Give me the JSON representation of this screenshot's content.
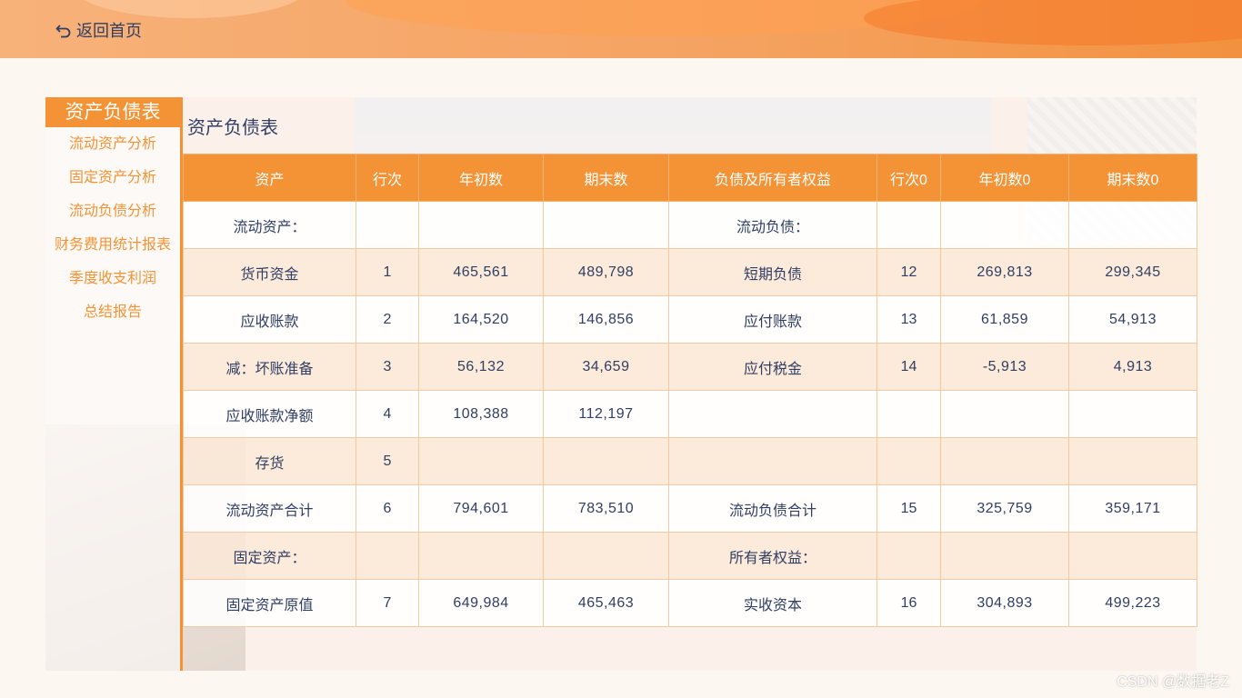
{
  "header": {
    "back_label": "返回首页"
  },
  "sidebar": {
    "title": "资产负债表",
    "items": [
      "流动资产分析",
      "固定资产分析",
      "流动负债分析",
      "财务费用统计报表",
      "季度收支利润",
      "总结报告"
    ]
  },
  "main": {
    "title": "资产负债表",
    "columns": [
      "资产",
      "行次",
      "年初数",
      "期末数",
      "负债及所有者权益",
      "行次0",
      "年初数0",
      "期末数0"
    ],
    "rows": [
      [
        "流动资产：",
        "",
        "",
        "",
        "流动负债：",
        "",
        "",
        ""
      ],
      [
        "货币资金",
        "1",
        "465,561",
        "489,798",
        "短期负债",
        "12",
        "269,813",
        "299,345"
      ],
      [
        "应收账款",
        "2",
        "164,520",
        "146,856",
        "应付账款",
        "13",
        "61,859",
        "54,913"
      ],
      [
        "减：坏账准备",
        "3",
        "56,132",
        "34,659",
        "应付税金",
        "14",
        "-5,913",
        "4,913"
      ],
      [
        "应收账款净额",
        "4",
        "108,388",
        "112,197",
        "",
        "",
        "",
        ""
      ],
      [
        "存货",
        "5",
        "",
        "",
        "",
        "",
        "",
        ""
      ],
      [
        "流动资产合计",
        "6",
        "794,601",
        "783,510",
        "流动负债合计",
        "15",
        "325,759",
        "359,171"
      ],
      [
        "固定资产：",
        "",
        "",
        "",
        "所有者权益：",
        "",
        "",
        ""
      ],
      [
        "固定资产原值",
        "7",
        "649,984",
        "465,463",
        "实收资本",
        "16",
        "304,893",
        "499,223"
      ]
    ]
  },
  "watermark": "CSDN @数据老Z",
  "colors": {
    "accent": "#f39335",
    "text": "#2f3e63"
  },
  "icons": {
    "back": "undo-arrow-icon"
  }
}
